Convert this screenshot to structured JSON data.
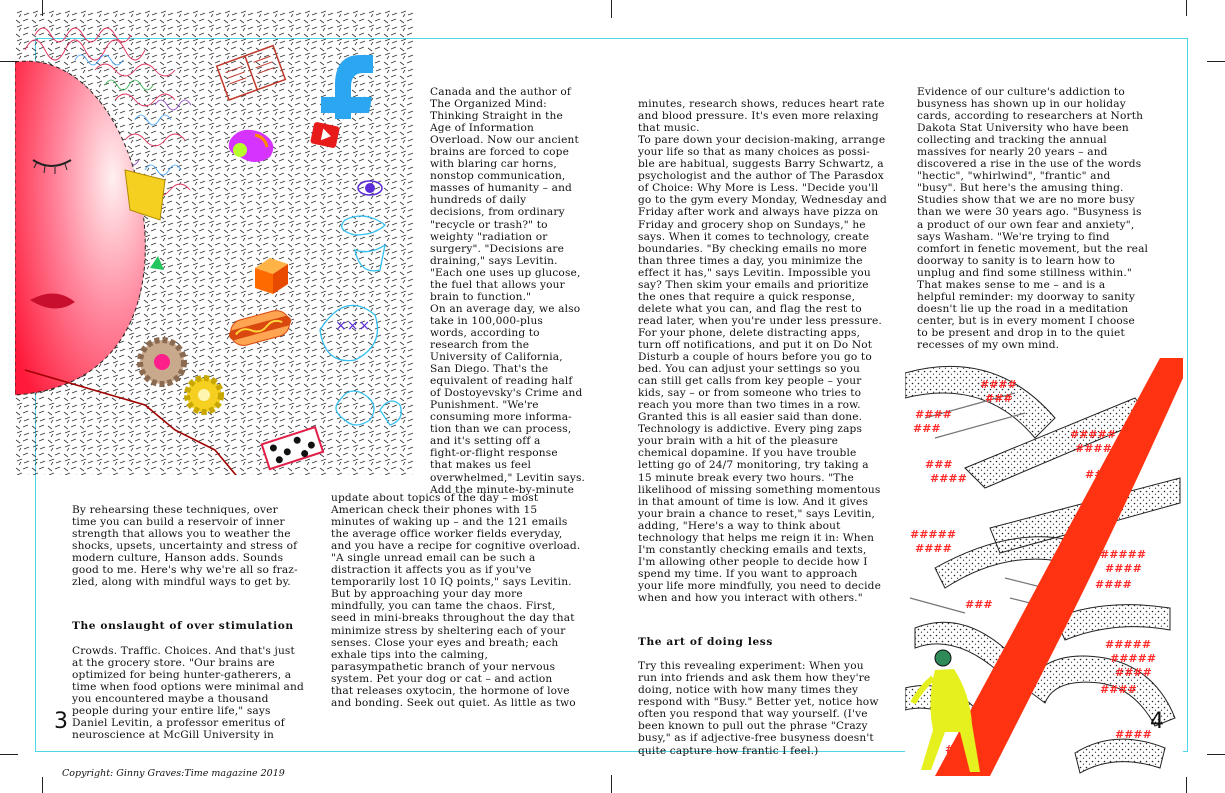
{
  "left_page": {
    "page_number": "3",
    "col1_intro": "Canada and the author of\nThe Organized Mind:\nThinking Straight in the\nAge of Information\nOverload. Now our ancient\nbrains are forced to cope\nwith blaring car horns,\nnonstop communication,\nmasses of humanity – and\nhundreds of daily\ndecisions, from ordinary\n\"recycle or trash?\" to\nweighty \"radiation or\nsurgery\". \"Decisions are\ndraining,\" says Levitin.\n\"Each one uses up glucose,\nthe fuel that allows your\nbrain to function.\"\nOn an average day, we also\ntake in 100,000-plus\nwords, according to\nresearch from the\nUniversity of California,\nSan Diego. That's the\nequivalent of reading half\nof Dostoyevsky's Crime and\nPunishment. \"We're\nconsuming more informa-\ntion than we can process,\nand it's setting off a\nfight-or-flight response\nthat makes us feel\noverwhelmed,\" Levitin says.\nAdd the minute-by-minute",
    "col_a_text": "By rehearsing these techniques, over\ntime you can build a reservoir of inner\nstrength that allows you to weather the\nshocks, upsets, uncertainty and stress of\nmodern culture, Hanson adds. Sounds\ngood to me. Here's why we're all so fraz-\nzled, along with mindful ways to get by.",
    "col_a_heading": "The onslaught of over stimulation",
    "col_a_text2": "Crowds. Traffic. Choices. And that's just\nat the grocery store. \"Our brains are\noptimized for being hunter-gatherers, a\ntime when food options were minimal and\nyou encountered maybe a thousand\npeople during your entire life,\" says\nDaniel Levitin, a professor emeritus of\nneuroscience at McGill University in",
    "col_b_text": "update about topics of the day – most\nAmerican check their phones with 15\nminutes of waking up – and the 121 emails\nthe average office worker fields everyday,\nand you have a recipe for cognitive overload.\n\"A single unread email can be such a\ndistraction it affects you as if you've\ntemporarily lost 10 IQ points,\" says Levitin.\nBut by approaching your day more\nmindfully, you can tame the chaos. First,\nseed in mini-breaks throughout the day that\nminimize stress by sheltering each of your\nsenses. Close your eyes and breath; each\nexhale tips into the calming,\nparasympathetic branch of your nervous\nsystem. Pet your dog or cat – and action\nthat releases oxytocin, the hormone of love\nand bonding. Seek out quiet. As little as two"
  },
  "right_page": {
    "page_number": "4",
    "col_c_text": "minutes, research shows, reduces heart rate\nand blood pressure. It's even more relaxing\nthat music.\nTo pare down your decision-making, arrange\nyour life so that as many choices as possi-\nble are habitual, suggests Barry Schwartz, a\npsychologist and the author of The Parasdox\nof Choice: Why More is Less. \"Decide you'll\ngo to the gym every Monday, Wednesday and\nFriday after work and always have pizza on\nFriday and grocery shop on Sundays,\" he\nsays. When it comes to technology, create\nboundaries. \"By checking emails no more\nthan three times a day, you minimize the\neffect it has,\" says Levitin. Impossible you\nsay? Then skim your emails and prioritize\nthe ones that require a quick response,\ndelete what you can, and flag the rest to\nread later, when you're under less pressure.\nFor your phone, delete distracting apps,\nturn off notifications, and put it on Do Not\nDisturb a couple of hours before you go to\nbed. You can adjust your settings so you\ncan still get calls from key people – your\nkids, say – or from someone who tries to\nreach you more than two times in a row.\nGranted this is all easier said than done.\nTechnology is addictive. Every ping zaps\nyour brain with a hit of the pleasure\nchemical dopamine. If you have trouble\nletting go of 24/7 monitoring, try taking a\n15 minute break every two hours. \"The\nlikelihood of missing something momentous\nin that amount of time is low. And it gives\nyour brain a chance to reset,\" says Levitin,\nadding, \"Here's a way to think about\ntechnology that helps me reign it in: When\nI'm constantly checking emails and texts,\nI'm allowing other people to decide how I\nspend my time. If you want to approach\nyour life more mindfully, you need to decide\nwhen and how you interact with others.\"",
    "col_c_heading": "The art of doing less",
    "col_c_text2": "Try this revealing experiment: When you\nrun into friends and ask them how they're\ndoing, notice with how many times they\nrespond with \"Busy.\" Better yet, notice how\noften you respond that way yourself. (I've\nbeen known to pull out the phrase \"Crazy\nbusy,\" as if adjective-free busyness doesn't\nquite capture how frantic I feel.)",
    "col_d_text": "Evidence of our culture's addiction to\nbusyness has shown up in our holiday\ncards, according to researchers at North\nDakota Stat University who have been\ncollecting and tracking the annual\nmassives for nearly 20 years – and\ndiscovered a rise in the use of the words\n\"hectic\", \"whirlwind\", \"frantic\" and\n\"busy\". But here's the amusing thing.\nStudies show that we are no more busy\nthan we were 30 years ago. \"Busyness is\na product of our own fear and anxiety\",\nsays Washam. \"We're trying to find\ncomfort in fenetic movement, but the real\ndoorway to sanity is to learn how to\nunplug and find some stillness within.\"\nThat makes sense to me – and is a\nhelpful reminder: my doorway to sanity\ndoesn't lie up the road in a meditation\ncenter, but is in every moment I choose\nto be present and drop in to the quiet\nrecesses of my own mind."
  },
  "footer": {
    "copyright": "Copyright: Ginny Graves:Time magazine 2019"
  },
  "colors": {
    "frame": "#4fd6e6",
    "accent_red": "#ff3311",
    "face_pink": "#ff4d6d",
    "hashtag_red": "#ff2a2a"
  },
  "art": {
    "left_illustration": [
      "face-icon",
      "facebook-icon",
      "youtube-icon",
      "book-icon",
      "gear-icon",
      "cube-icon",
      "hotdog-icon"
    ],
    "right_illustration": [
      "road-icon",
      "walking-figure-icon",
      "hashtag-icon"
    ]
  }
}
